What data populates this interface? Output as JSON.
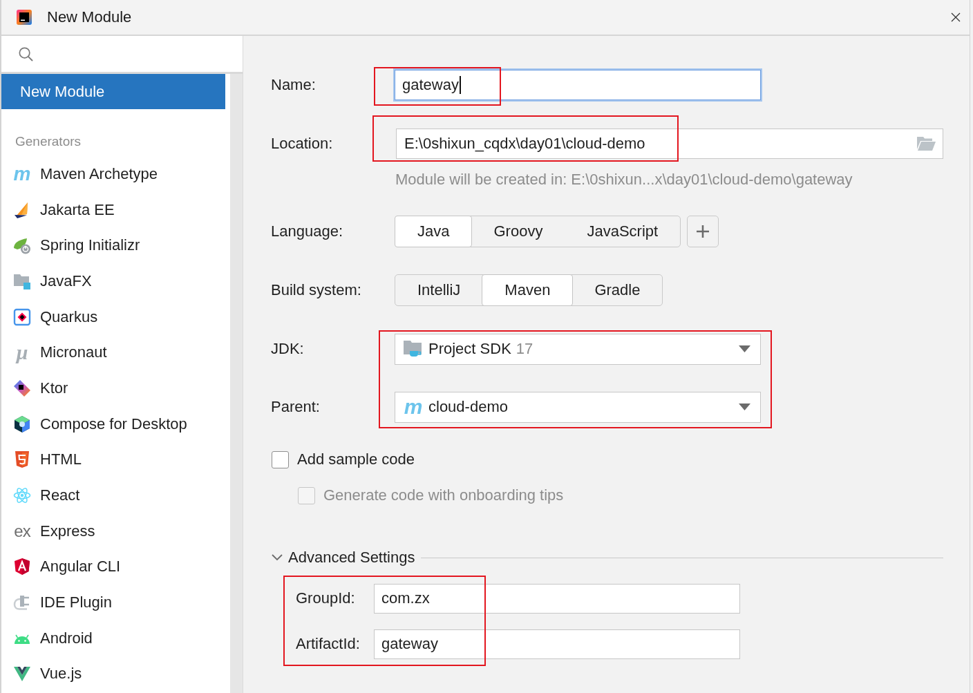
{
  "window": {
    "title": "New Module"
  },
  "sidebar": {
    "items": [
      {
        "label": "New Module",
        "selected": true
      }
    ],
    "groups": [
      {
        "title": "Generators",
        "items": [
          {
            "label": "Maven Archetype",
            "selected": false,
            "glyph": "m"
          },
          {
            "label": "Jakarta EE",
            "selected": false
          },
          {
            "label": "Spring Initializr",
            "selected": false
          },
          {
            "label": "JavaFX",
            "selected": false
          },
          {
            "label": "Quarkus",
            "selected": false
          },
          {
            "label": "Micronaut",
            "selected": false,
            "glyph": "μ"
          },
          {
            "label": "Ktor",
            "selected": false
          },
          {
            "label": "Compose for Desktop",
            "selected": false
          },
          {
            "label": "HTML",
            "selected": false
          },
          {
            "label": "React",
            "selected": false
          },
          {
            "label": "Express",
            "selected": false,
            "glyph": "ex"
          },
          {
            "label": "Angular CLI",
            "selected": false
          },
          {
            "label": "IDE Plugin",
            "selected": false
          },
          {
            "label": "Android",
            "selected": false
          },
          {
            "label": "Vue.js",
            "selected": false
          }
        ]
      }
    ]
  },
  "form": {
    "name": {
      "label": "Name:",
      "value": "gateway",
      "focused": true
    },
    "location": {
      "label": "Location:",
      "value": "E:\\0shixun_cqdx\\day01\\cloud-demo",
      "hint": "Module will be created in: E:\\0shixun...x\\day01\\cloud-demo\\gateway"
    },
    "language": {
      "label": "Language:",
      "options": [
        {
          "label": "Java",
          "selected": true
        },
        {
          "label": "Groovy",
          "selected": false
        },
        {
          "label": "JavaScript",
          "selected": false
        }
      ]
    },
    "build_system": {
      "label": "Build system:",
      "options": [
        {
          "label": "IntelliJ",
          "selected": false
        },
        {
          "label": "Maven",
          "selected": true
        },
        {
          "label": "Gradle",
          "selected": false
        }
      ]
    },
    "jdk": {
      "label": "JDK:",
      "value": "Project SDK",
      "version": "17"
    },
    "parent": {
      "label": "Parent:",
      "glyph": "m",
      "value": "cloud-demo"
    },
    "add_sample_code": {
      "label": "Add sample code",
      "checked": false,
      "disabled": false
    },
    "onboarding_tips": {
      "label": "Generate code with onboarding tips",
      "checked": false,
      "disabled": true
    },
    "advanced_settings": {
      "title": "Advanced Settings",
      "expanded": true,
      "fields": [
        {
          "label": "GroupId:",
          "value": "com.zx"
        },
        {
          "label": "ArtifactId:",
          "value": "gateway"
        }
      ]
    }
  },
  "annotations": [
    {
      "kind": "name"
    },
    {
      "kind": "location"
    },
    {
      "kind": "jdk_parent"
    },
    {
      "kind": "ids"
    }
  ]
}
